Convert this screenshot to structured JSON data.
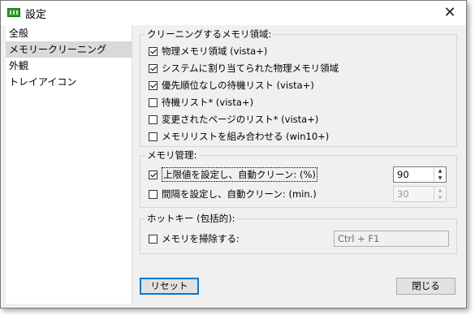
{
  "window": {
    "title": "設定",
    "close_glyph": "✕"
  },
  "sidebar": {
    "items": [
      {
        "label": "全般",
        "selected": false
      },
      {
        "label": "メモリークリーニング",
        "selected": true
      },
      {
        "label": "外観",
        "selected": false
      },
      {
        "label": "トレイアイコン",
        "selected": false
      }
    ]
  },
  "cleaning": {
    "group_label": "クリーニングするメモリ領域:",
    "options": [
      {
        "label": "物理メモリ領域 (vista+)",
        "checked": true
      },
      {
        "label": "システムに割り当てられた物理メモリ領域",
        "checked": true
      },
      {
        "label": "優先順位なしの待機リスト (vista+)",
        "checked": true
      },
      {
        "label": "待機リスト* (vista+)",
        "checked": false
      },
      {
        "label": "変更されたページのリスト* (vista+)",
        "checked": false
      },
      {
        "label": "メモリリストを組み合わせる (win10+)",
        "checked": false
      }
    ]
  },
  "memory": {
    "group_label": "メモリ管理:",
    "limit": {
      "label": "上限値を設定し、自動クリーン: (%)",
      "checked": true,
      "value": "90"
    },
    "interval": {
      "label": "間隔を設定し、自動クリーン: (min.)",
      "checked": false,
      "value": "30"
    }
  },
  "hotkey": {
    "group_label": "ホットキー (包括的):",
    "clean": {
      "label": "メモリを掃除する:",
      "checked": false,
      "value": "Ctrl + F1"
    }
  },
  "buttons": {
    "reset": "リセット",
    "close": "閉じる"
  }
}
